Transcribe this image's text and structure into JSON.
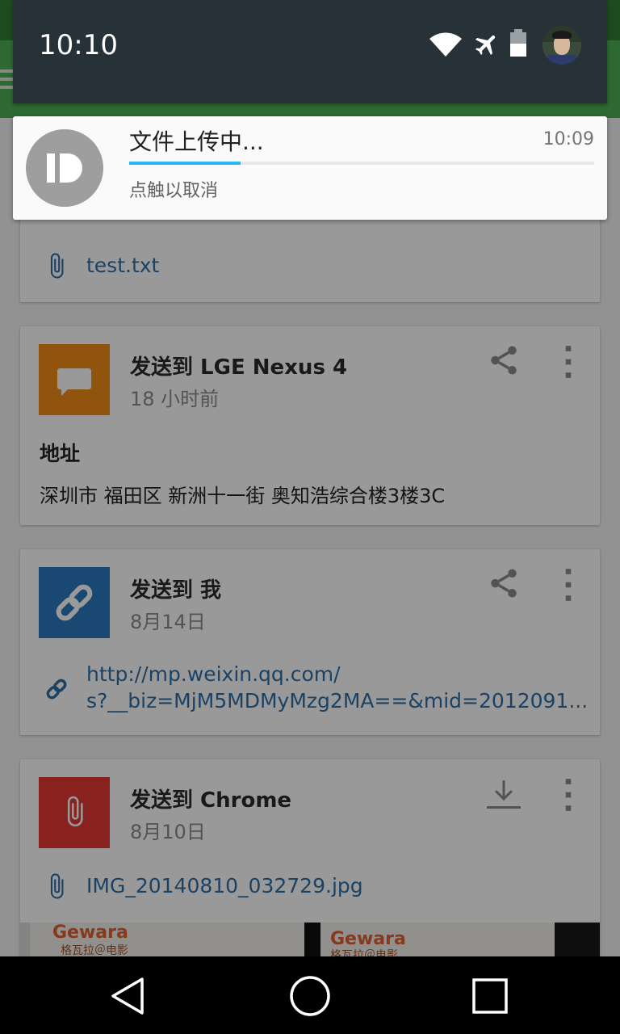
{
  "status_bar": {
    "time": "10:10",
    "icons": [
      "wifi-icon",
      "airplane-icon",
      "battery-icon",
      "user-avatar"
    ]
  },
  "notification": {
    "title": "文件上传中...",
    "time": "10:09",
    "text": "点触以取消",
    "progress_percent": 24,
    "icon": "pushbullet-icon",
    "progress_color": "#29b6f6"
  },
  "cards": {
    "file_card": {
      "attachment": "test.txt",
      "thumb_color": "#d32f2f"
    },
    "nexus_card": {
      "title": "发送到 LGE Nexus 4",
      "subtitle": "18 小时前",
      "heading": "地址",
      "body": "深圳市 福田区 新洲十一街 奥知浩综合楼3楼3C",
      "thumb_color": "#f28c1a",
      "thumb_icon": "message-icon"
    },
    "me_card": {
      "title": "发送到 我",
      "subtitle": "8月14日",
      "link_line1": "http://mp.weixin.qq.com/",
      "link_line2": "s?__biz=MjM5MDMyMzg2MA==&mid=2012091...",
      "thumb_color": "#2a7bc0",
      "thumb_icon": "link-icon"
    },
    "chrome_card": {
      "title": "发送到 Chrome",
      "subtitle": "8月10日",
      "attachment": "IMG_20140810_032729.jpg",
      "thumb_color": "#e53935",
      "thumb_icon": "paperclip-icon"
    }
  },
  "photo_preview": {
    "brand_en": "Gewara",
    "brand_cn": "格瓦拉＠电影"
  },
  "colors": {
    "app_bar": "#4caf50",
    "status_bar": "#263238",
    "link": "#2f6fa6"
  },
  "nav_bar": {
    "icons": [
      "back-icon",
      "home-icon",
      "recents-icon"
    ]
  }
}
